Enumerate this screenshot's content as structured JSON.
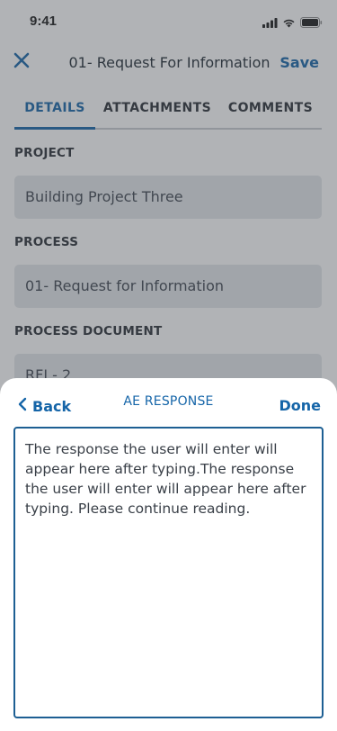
{
  "status_bar": {
    "time": "9:41"
  },
  "nav": {
    "title": "01- Request For Information",
    "save_label": "Save"
  },
  "tabs": [
    {
      "label": "DETAILS",
      "active": true
    },
    {
      "label": "ATTACHMENTS",
      "active": false
    },
    {
      "label": "COMMENTS",
      "active": false
    }
  ],
  "form": {
    "project": {
      "label": "PROJECT",
      "value": "Building Project Three"
    },
    "process": {
      "label": "PROCESS",
      "value": "01- Request for Information"
    },
    "process_document": {
      "label": "PROCESS DOCUMENT",
      "value": "RFI - 2"
    }
  },
  "sheet": {
    "back_label": "Back",
    "title": "AE RESPONSE",
    "done_label": "Done",
    "response_text": "The response the user will enter will appear here after typing.The response the user will enter will appear here after typing. Please continue reading."
  },
  "colors": {
    "accent": "#1565a8",
    "field_bg": "#e4e7eb",
    "overlay": "rgba(70,75,82,0.42)"
  },
  "icons": [
    "close-icon",
    "chevron-left-icon",
    "signal-icon",
    "wifi-icon",
    "battery-icon"
  ]
}
